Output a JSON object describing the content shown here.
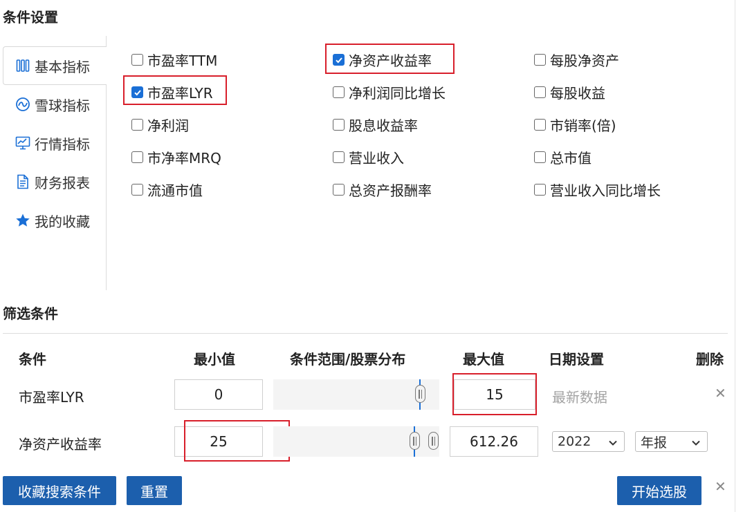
{
  "condition_settings": {
    "title": "条件设置",
    "tabs": [
      {
        "label": "基本指标",
        "icon": "bars-icon",
        "active": true
      },
      {
        "label": "雪球指标",
        "icon": "snowball-icon",
        "active": false
      },
      {
        "label": "行情指标",
        "icon": "monitor-chart-icon",
        "active": false
      },
      {
        "label": "财务报表",
        "icon": "document-icon",
        "active": false
      },
      {
        "label": "我的收藏",
        "icon": "star-icon",
        "active": false
      }
    ],
    "checkboxes": [
      {
        "label": "市盈率TTM",
        "checked": false
      },
      {
        "label": "净资产收益率",
        "checked": true
      },
      {
        "label": "每股净资产",
        "checked": false
      },
      {
        "label": "市盈率LYR",
        "checked": true
      },
      {
        "label": "净利润同比增长",
        "checked": false
      },
      {
        "label": "每股收益",
        "checked": false
      },
      {
        "label": "净利润",
        "checked": false
      },
      {
        "label": "股息收益率",
        "checked": false
      },
      {
        "label": "市销率(倍)",
        "checked": false
      },
      {
        "label": "市净率MRQ",
        "checked": false
      },
      {
        "label": "营业收入",
        "checked": false
      },
      {
        "label": "总市值",
        "checked": false
      },
      {
        "label": "流通市值",
        "checked": false
      },
      {
        "label": "总资产报酬率",
        "checked": false
      },
      {
        "label": "营业收入同比增长",
        "checked": false
      }
    ]
  },
  "filter": {
    "title": "筛选条件",
    "headers": {
      "condition": "条件",
      "min": "最小值",
      "range": "条件范围/股票分布",
      "max": "最大值",
      "date": "日期设置",
      "delete": "删除"
    },
    "rows": [
      {
        "label": "市盈率LYR",
        "min": "0",
        "max": "15",
        "date_text": "最新数据"
      },
      {
        "label": "净资产收益率",
        "min": "25",
        "max": "612.26",
        "year": "2022",
        "period": "年报"
      }
    ]
  },
  "actions": {
    "save": "收藏搜索条件",
    "reset": "重置",
    "start": "开始选股"
  },
  "colors": {
    "accent": "#1a6fd6",
    "button": "#1c5fad",
    "highlight": "#d81e2a"
  }
}
